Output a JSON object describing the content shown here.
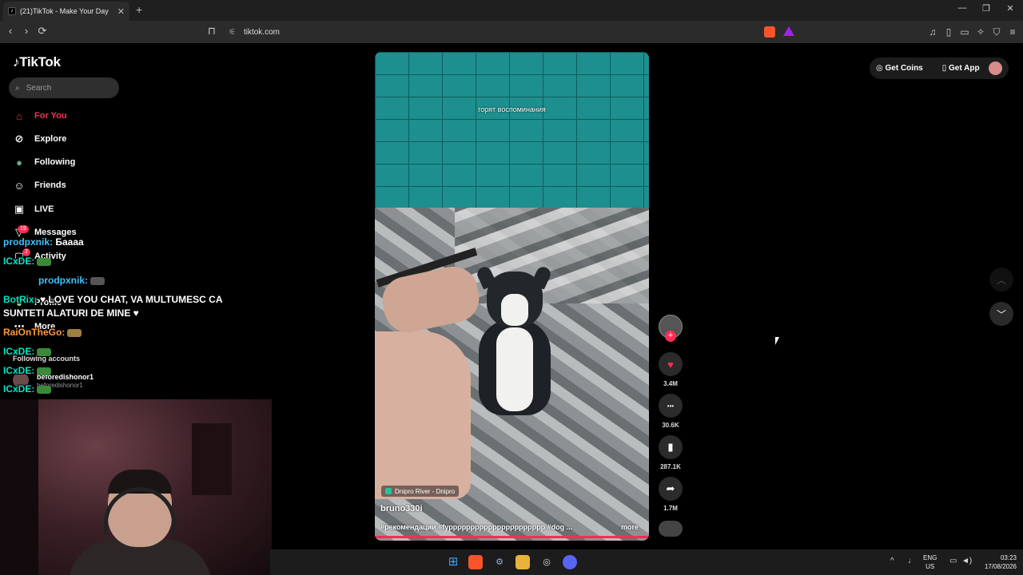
{
  "browser": {
    "tab_title": "(21)TikTok - Make Your Day",
    "tab_favicon": "♪",
    "close_glyph": "✕",
    "new_tab_glyph": "+",
    "url": "tiktok.com",
    "nav": {
      "back": "‹",
      "forward": "›",
      "reload": "⟳"
    }
  },
  "sidebar": {
    "logo": "TikTok",
    "search_placeholder": "Search",
    "items": [
      {
        "label": "For You",
        "icon": "home-icon",
        "glyph": "⌂"
      },
      {
        "label": "Explore",
        "icon": "compass-icon",
        "glyph": "⊘"
      },
      {
        "label": "Following",
        "icon": "avatar-icon",
        "glyph": "●"
      },
      {
        "label": "Friends",
        "icon": "people-icon",
        "glyph": "☺"
      },
      {
        "label": "LIVE",
        "icon": "live-icon",
        "glyph": "▣"
      },
      {
        "label": "Messages",
        "icon": "message-icon",
        "glyph": "▽",
        "badge": "19"
      },
      {
        "label": "Activity",
        "icon": "activity-icon",
        "glyph": "▢",
        "badge": "2"
      },
      {
        "label": "Profile",
        "icon": "profile-icon",
        "glyph": "●"
      },
      {
        "label": "More",
        "icon": "more-icon",
        "glyph": "⋯"
      }
    ],
    "following_accounts_label": "Following accounts",
    "account": {
      "name": "beforedishonor1",
      "handle": "beforedishonor1"
    }
  },
  "chat": [
    {
      "user": "prodpxnik:",
      "msg": "Баааа"
    },
    {
      "user": "ICxDE:",
      "msg": ""
    },
    {
      "user": "prodpxnik:",
      "msg": ""
    },
    {
      "user": "BotRix:",
      "msg": "♥ LOVE YOU CHAT, VA MULTUMESC CA"
    },
    {
      "user": "",
      "msg": "SUNTETI ALATURI DE MINE ♥"
    },
    {
      "user": "RaiOnTheGo:",
      "msg": ""
    },
    {
      "user": "ICxDE:",
      "msg": ""
    },
    {
      "user": "ICxDE:",
      "msg": ""
    },
    {
      "user": "ICxDE:",
      "msg": ""
    }
  ],
  "video": {
    "overlay_text": "горят воспоминания",
    "location": "Dnipro River - Dnipro",
    "author": "bruno330i",
    "description": "#рекомендации #fypppppppppppppppppppppp #dog ...",
    "more_label": "more"
  },
  "actions": {
    "likes": "3.4M",
    "comments": "30.6K",
    "saves": "287.1K",
    "shares": "1.7M",
    "follow_glyph": "+",
    "like_glyph": "♥",
    "comment_glyph": "•••",
    "save_glyph": "▮",
    "share_glyph": "➦"
  },
  "topright": {
    "coins_label": "Get Coins",
    "app_label": "Get App"
  },
  "scroll": {
    "up": "︿",
    "down": "﹀"
  },
  "taskbar": {
    "lang_line1": "ENG",
    "lang_line2": "US",
    "time": "03:23",
    "date": "17/08/2026"
  },
  "colors": {
    "accent": "#fe2c55",
    "background": "#000000"
  }
}
